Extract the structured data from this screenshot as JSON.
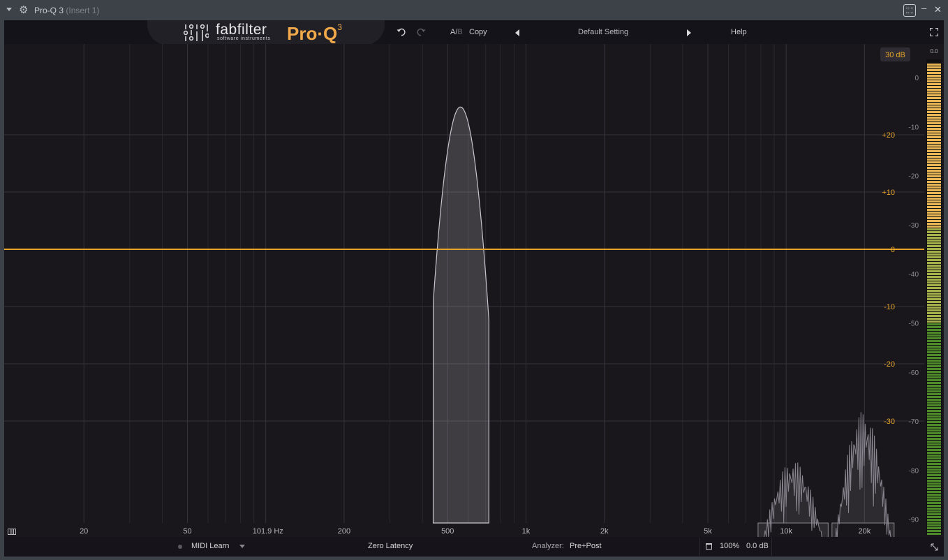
{
  "window": {
    "title": "Pro-Q 3",
    "subtitle": "(Insert 1)",
    "minimize_label": "–",
    "close_label": "✕",
    "gear_glyph": "⚙"
  },
  "header": {
    "brand": "fabfilter",
    "brand_sub": "software instruments",
    "product": "Pro·Q",
    "product_version": "3",
    "ab_a": "A/",
    "ab_b": "B",
    "copy": "Copy",
    "preset": "Default Setting",
    "help": "Help"
  },
  "graph": {
    "range_button": "30 dB",
    "freq_labels": [
      {
        "text": "20",
        "hz": 20
      },
      {
        "text": "50",
        "hz": 50
      },
      {
        "text": "101.9 Hz",
        "hz": 101.9
      },
      {
        "text": "200",
        "hz": 200
      },
      {
        "text": "500",
        "hz": 500
      },
      {
        "text": "1k",
        "hz": 1000
      },
      {
        "text": "2k",
        "hz": 2000
      },
      {
        "text": "5k",
        "hz": 5000
      },
      {
        "text": "10k",
        "hz": 10000
      },
      {
        "text": "20k",
        "hz": 20000
      }
    ],
    "eq_db_labels": [
      {
        "text": "+20",
        "db": 20
      },
      {
        "text": "+10",
        "db": 10
      },
      {
        "text": "0",
        "db": 0
      },
      {
        "text": "-10",
        "db": -10
      },
      {
        "text": "-20",
        "db": -20
      },
      {
        "text": "-30",
        "db": -30
      }
    ],
    "analyzer_db_labels": [
      "0",
      "-10",
      "-20",
      "-30",
      "-40",
      "-50",
      "-60",
      "-70",
      "-80",
      "-90"
    ],
    "eq_range_db": [
      -36,
      36
    ],
    "analyzer_range_db": [
      -100,
      0
    ],
    "freq_range_hz": [
      10,
      30000
    ],
    "eq_curve_db": 0,
    "colors": {
      "eq_line": "#e6a52a",
      "eq_label": "#e6a52a",
      "analyzer_label": "#8e8c92",
      "grid": "#2a282e",
      "grid_major": "#35333a",
      "background": "#19171c"
    }
  },
  "meter": {
    "peak_label": "0.0",
    "colors": {
      "top": "#e9b655",
      "mid": "#a6b04a",
      "bottom": "#4f8a2a"
    }
  },
  "footer": {
    "midi_learn": "MIDI Learn",
    "latency": "Zero Latency",
    "analyzer_label": "Analyzer:",
    "analyzer_value": "Pre+Post",
    "output_level": "100%",
    "output_gain": "0.0 dB"
  }
}
